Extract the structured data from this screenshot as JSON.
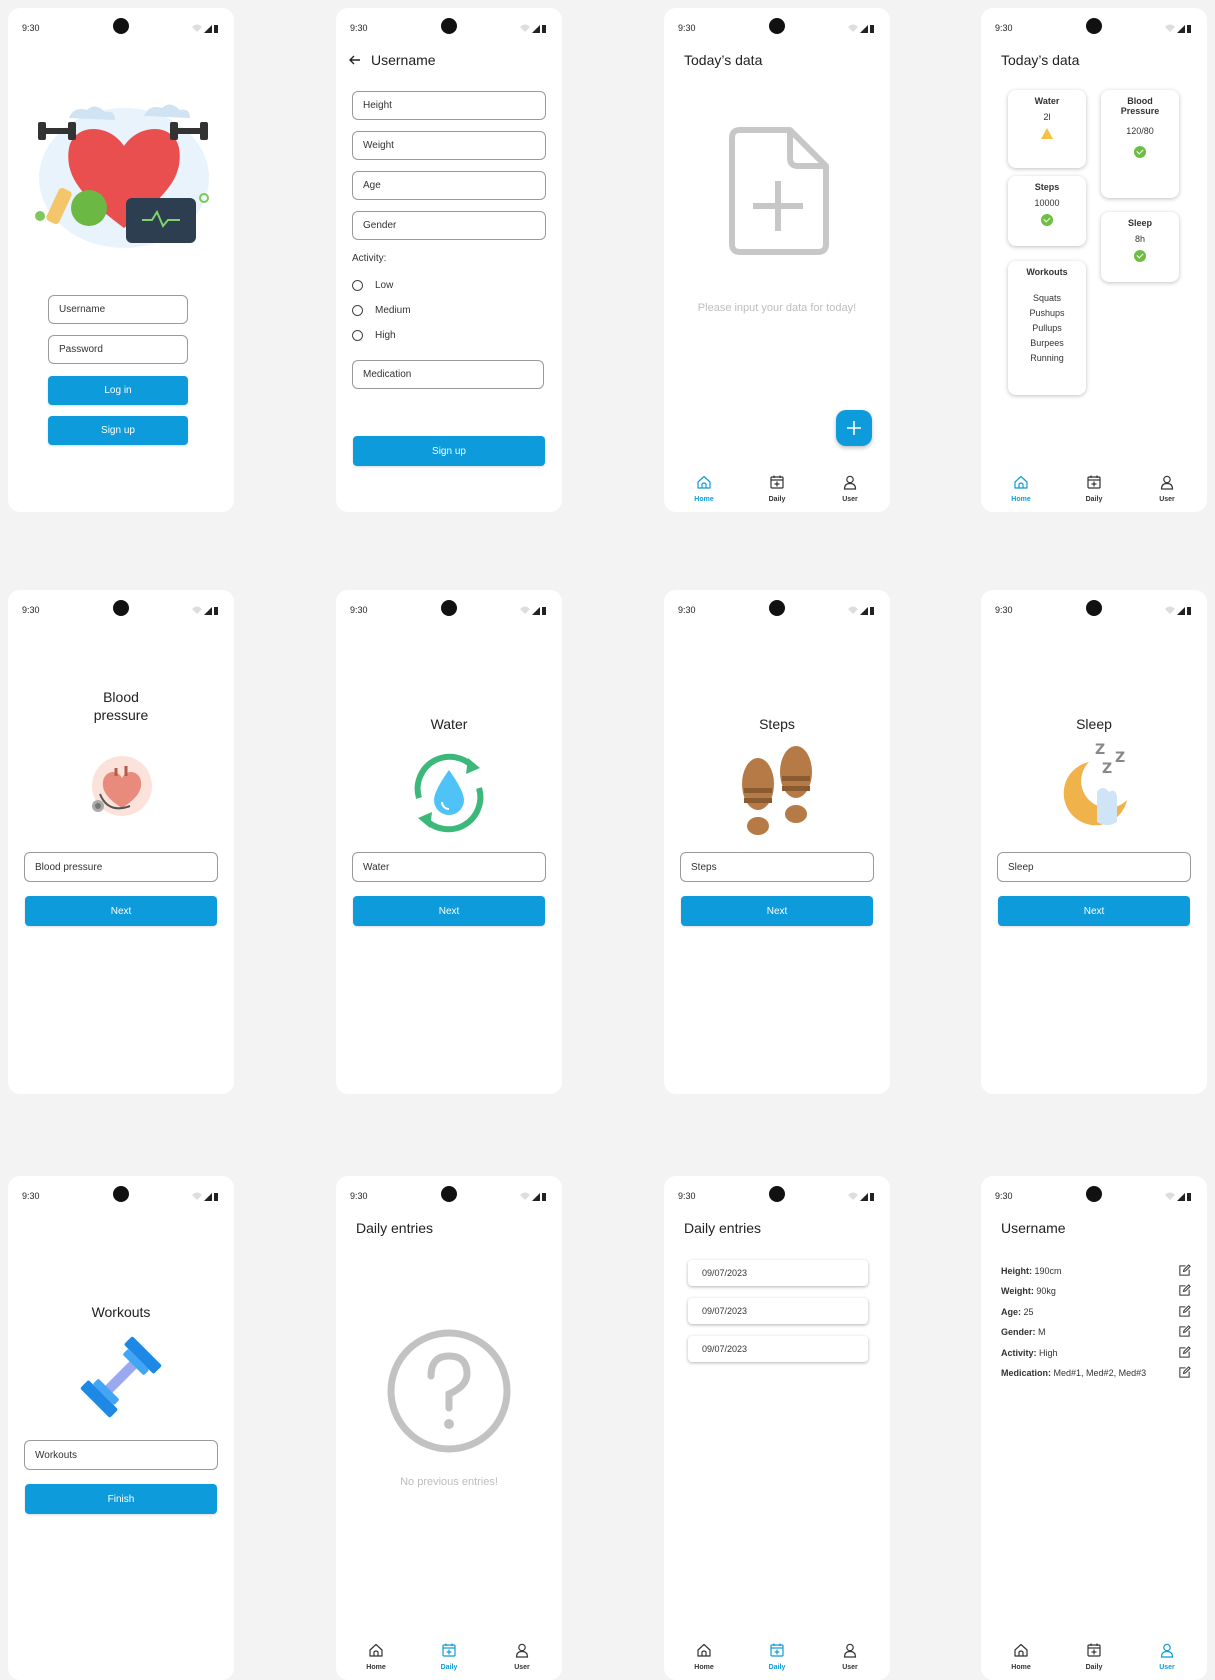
{
  "status": {
    "time": "9:30"
  },
  "login": {
    "username_placeholder": "Username",
    "password_placeholder": "Password",
    "login_label": "Log in",
    "signup_label": "Sign up"
  },
  "signup": {
    "title": "Username",
    "fields": [
      "Height",
      "Weight",
      "Age",
      "Gender"
    ],
    "activity_label": "Activity:",
    "activity_options": [
      "Low",
      "Medium",
      "High"
    ],
    "medication_placeholder": "Medication",
    "signup_label": "Sign up"
  },
  "today_empty": {
    "title": "Today’s data",
    "message": "Please input your data for today!"
  },
  "today_data": {
    "title": "Today’s data",
    "water": {
      "label": "Water",
      "value": "2l"
    },
    "blood_pressure": {
      "label": "Blood Pressure",
      "value": "120/80"
    },
    "steps": {
      "label": "Steps",
      "value": "10000"
    },
    "sleep": {
      "label": "Sleep",
      "value": "8h"
    },
    "workouts": {
      "label": "Workouts",
      "items": [
        "Squats",
        "Pushups",
        "Pullups",
        "Burpees",
        "Running"
      ]
    }
  },
  "nav": {
    "home": "Home",
    "daily": "Daily",
    "user": "User"
  },
  "entry_screens": [
    {
      "title": "Blood pressure",
      "placeholder": "Blood pressure",
      "button": "Next"
    },
    {
      "title": "Water",
      "placeholder": "Water",
      "button": "Next"
    },
    {
      "title": "Steps",
      "placeholder": "Steps",
      "button": "Next"
    },
    {
      "title": "Sleep",
      "placeholder": "Sleep",
      "button": "Next"
    },
    {
      "title": "Workouts",
      "placeholder": "Workouts",
      "button": "Finish"
    }
  ],
  "daily_empty": {
    "title": "Daily entries",
    "message": "No previous entries!"
  },
  "daily_list": {
    "title": "Daily entries",
    "entries": [
      "09/07/2023",
      "09/07/2023",
      "09/07/2023"
    ]
  },
  "profile": {
    "title": "Username",
    "rows": [
      {
        "label": "Height:",
        "value": "190cm"
      },
      {
        "label": "Weight:",
        "value": "90kg"
      },
      {
        "label": "Age:",
        "value": "25"
      },
      {
        "label": "Gender:",
        "value": "M"
      },
      {
        "label": "Activity:",
        "value": "High"
      },
      {
        "label": "Medication:",
        "value": "Med#1, Med#2, Med#3"
      }
    ]
  },
  "colors": {
    "accent": "#0d9bdb",
    "ok": "#6fbe44",
    "warn": "#f5c242",
    "muted": "#bdbdbd"
  }
}
